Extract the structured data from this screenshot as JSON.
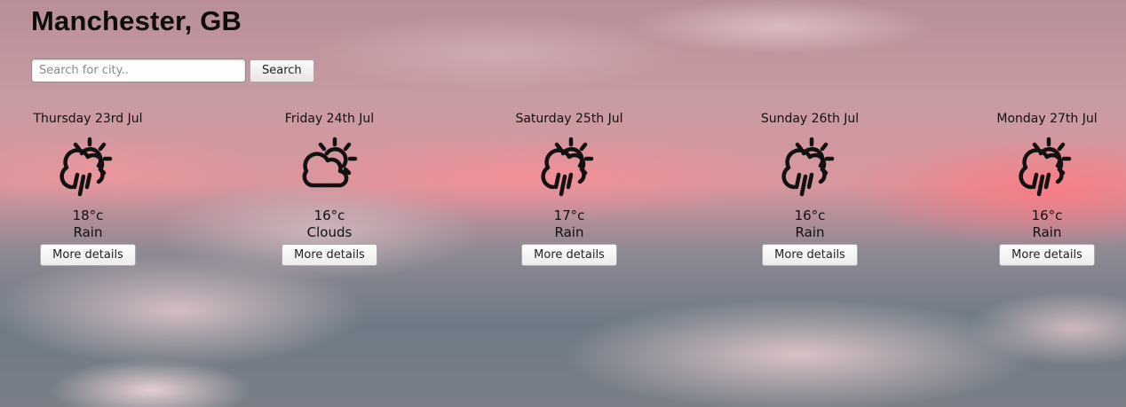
{
  "header": {
    "city_title": "Manchester, GB"
  },
  "search": {
    "placeholder": "Search for city..",
    "value": "",
    "button_label": "Search"
  },
  "forecast": [
    {
      "day": "Thursday 23rd Jul",
      "temp": "18°c",
      "condition": "Rain",
      "icon": "sun-cloud-rain-icon",
      "details_label": "More details"
    },
    {
      "day": "Friday 24th Jul",
      "temp": "16°c",
      "condition": "Clouds",
      "icon": "sun-cloud-icon",
      "details_label": "More details"
    },
    {
      "day": "Saturday 25th Jul",
      "temp": "17°c",
      "condition": "Rain",
      "icon": "sun-cloud-rain-icon",
      "details_label": "More details"
    },
    {
      "day": "Sunday 26th Jul",
      "temp": "16°c",
      "condition": "Rain",
      "icon": "sun-cloud-rain-icon",
      "details_label": "More details"
    },
    {
      "day": "Monday 27th Jul",
      "temp": "16°c",
      "condition": "Rain",
      "icon": "sun-cloud-rain-icon",
      "details_label": "More details"
    }
  ],
  "colors": {
    "text": "#111111",
    "button_border": "#a9a9a9",
    "sky_pink": "#d9969d",
    "sky_slate": "#6e7b86"
  }
}
